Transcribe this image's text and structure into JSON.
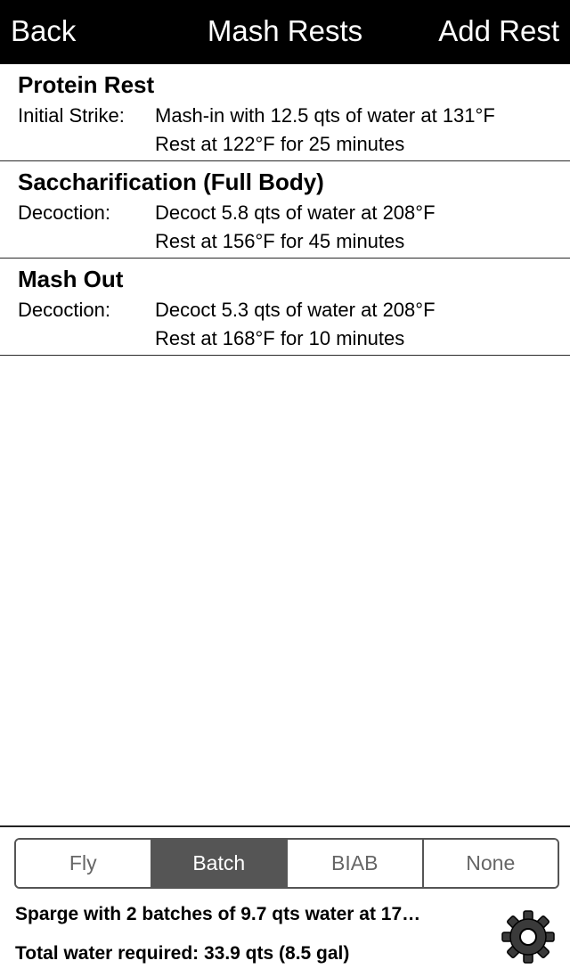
{
  "navbar": {
    "back_label": "Back",
    "title": "Mash Rests",
    "add_label": "Add Rest"
  },
  "rests": [
    {
      "name": "Protein Rest",
      "type": "Initial Strike:",
      "line1": "Mash-in with 12.5 qts of water at 131°F",
      "line2": "Rest at 122°F for 25 minutes"
    },
    {
      "name": "Saccharification (Full Body)",
      "type": "Decoction:",
      "line1": "Decoct 5.8 qts of water at 208°F",
      "line2": "Rest at 156°F for 45 minutes"
    },
    {
      "name": "Mash Out",
      "type": "Decoction:",
      "line1": "Decoct 5.3 qts of water at 208°F",
      "line2": "Rest at 168°F for 10 minutes"
    }
  ],
  "sparge": {
    "options": [
      "Fly",
      "Batch",
      "BIAB",
      "None"
    ],
    "selected": "Batch",
    "summary": "Sparge with 2 batches of 9.7 qts water at 17…",
    "total": "Total water required: 33.9 qts (8.5 gal)",
    "settings_icon": "gear-icon"
  },
  "colors": {
    "navbar_bg": "#000000",
    "segment_selected": "#555555",
    "segment_text": "#666666"
  }
}
